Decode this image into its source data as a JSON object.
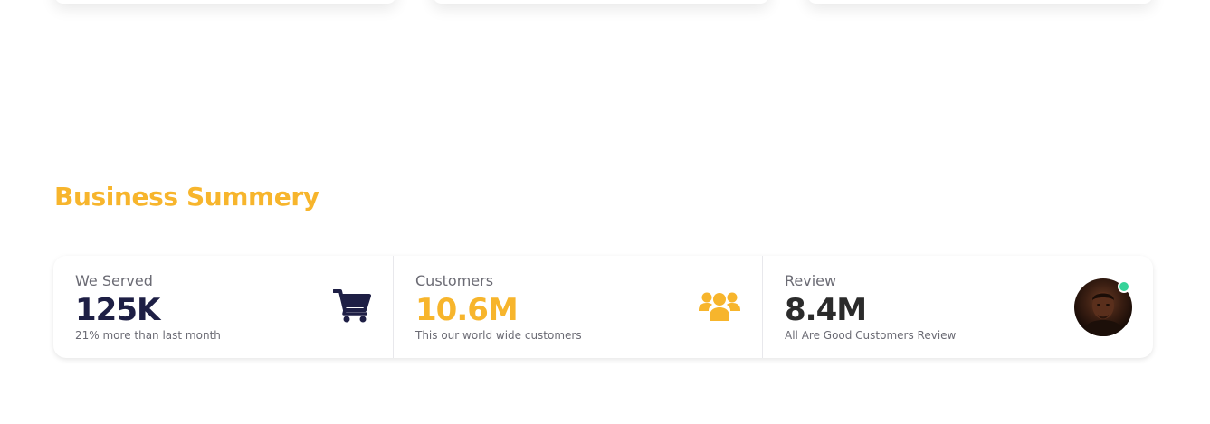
{
  "section": {
    "title": "Business Summery"
  },
  "stats": [
    {
      "title": "We Served",
      "value": "125K",
      "desc": "21% more than last month",
      "value_color": "#1e1f45",
      "icon": "shopping-cart-icon",
      "icon_color": "#1e1f45"
    },
    {
      "title": "Customers",
      "value": "10.6M",
      "desc": "This our world wide customers",
      "value_color": "#f7b52c",
      "icon": "users-icon",
      "icon_color": "#f7b52c"
    },
    {
      "title": "Review",
      "value": "8.4M",
      "desc": "All Are Good Customers Review",
      "value_color": "#2b2b2b",
      "icon": "avatar",
      "status": "online",
      "status_color": "#36d399"
    }
  ],
  "colors": {
    "accent": "#f7b52c",
    "navy": "#1e1f45",
    "dark": "#2b2b2b",
    "muted": "#6b6b74"
  }
}
